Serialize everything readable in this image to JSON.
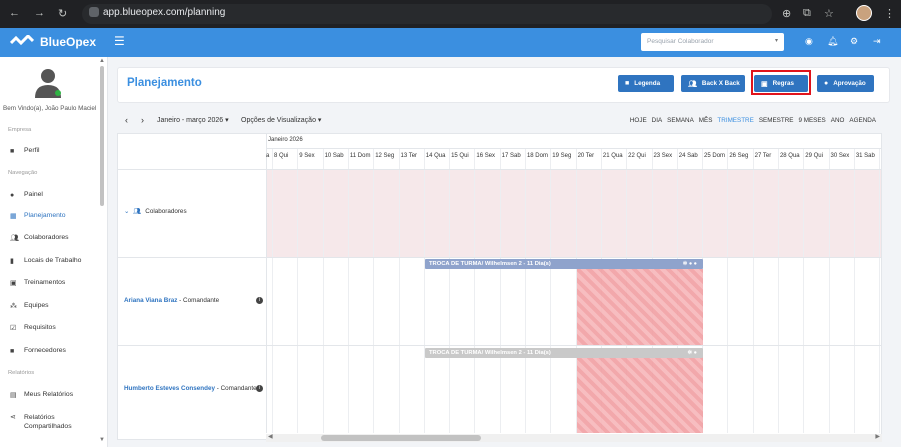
{
  "browser": {
    "url": "app.blueopex.com/planning",
    "nav_back": "←",
    "nav_forward": "→",
    "nav_reload": "↻",
    "right_icons": [
      "zoom-icon",
      "extension-icon",
      "star-icon",
      "profile-avatar",
      "more-icon"
    ]
  },
  "app": {
    "logo_text": "BlueOpex",
    "menu_icon": "☰",
    "search_placeholder": "Pesquisar Colaborador",
    "header_icons": [
      "headset-icon",
      "bell-icon",
      "gear-icon",
      "logout-icon"
    ]
  },
  "sidebar": {
    "welcome": "Bem Vindo(a), João Paulo Maciel",
    "sections": [
      {
        "label": "Empresa"
      },
      {
        "label": "Navegação"
      },
      {
        "label": "Relatórios"
      }
    ],
    "items": [
      {
        "label": "Perfil",
        "icon": "briefcase-icon"
      },
      {
        "label": "Painel",
        "icon": "gauge-icon"
      },
      {
        "label": "Planejamento",
        "icon": "calendar-icon",
        "active": true
      },
      {
        "label": "Colaboradores",
        "icon": "users-icon"
      },
      {
        "label": "Locais de Trabalho",
        "icon": "building-icon"
      },
      {
        "label": "Treinamentos",
        "icon": "training-icon"
      },
      {
        "label": "Equipes",
        "icon": "team-icon"
      },
      {
        "label": "Requisitos",
        "icon": "checkbox-icon"
      },
      {
        "label": "Fornecedores",
        "icon": "briefcase-icon"
      },
      {
        "label": "Meus Relatórios",
        "icon": "print-icon"
      },
      {
        "label": "Relatórios",
        "label2": "Compartilhados",
        "icon": "share-icon"
      }
    ]
  },
  "main": {
    "title": "Planejamento",
    "buttons": {
      "legenda": "Legenda",
      "backxback": "Back X Back",
      "regras": "Regras",
      "aprovacao": "Aprovação"
    },
    "toolbar": {
      "prev": "‹",
      "next": "›",
      "range": "Janeiro - março 2026",
      "options": "Opções de Visualização",
      "views": [
        "HOJE",
        "DIA",
        "SEMANA",
        "MÊS",
        "TRIMESTRE",
        "SEMESTRE",
        "9 MESES",
        "ANO",
        "AGENDA"
      ],
      "selected_view": "TRIMESTRE"
    },
    "calendar": {
      "month": "Janeiro 2026",
      "days": [
        "a",
        "8 Qui",
        "9 Sex",
        "10 Sab",
        "11 Dom",
        "12 Seg",
        "13 Ter",
        "14 Qua",
        "15 Qui",
        "16 Sex",
        "17 Sab",
        "18 Dom",
        "19 Seg",
        "20 Ter",
        "21 Qua",
        "22 Qui",
        "23 Sex",
        "24 Sab",
        "25 Dom",
        "26 Seg",
        "27 Ter",
        "28 Qua",
        "29 Qui",
        "30 Sex",
        "31 Sab"
      ]
    },
    "group_label": "Colaboradores",
    "resources": [
      {
        "name": "Ariana Viana Braz",
        "role": " - Comandante",
        "event": "TROCA DE TURMA/ Wilhelmsen 2 - 11 Dia(s)",
        "event_color": "#8fa3cc"
      },
      {
        "name": "Humberto Esteves Consendey",
        "role": " - Comandante",
        "event": "TROCA DE TURMA/ Wilhelmsen 2 - 11 Dia(s)",
        "event_color": "#c9c9c9"
      }
    ],
    "colors": {
      "primary": "#2f74c0",
      "accent": "#3b8fe0",
      "highlight": "#e0131b"
    }
  }
}
